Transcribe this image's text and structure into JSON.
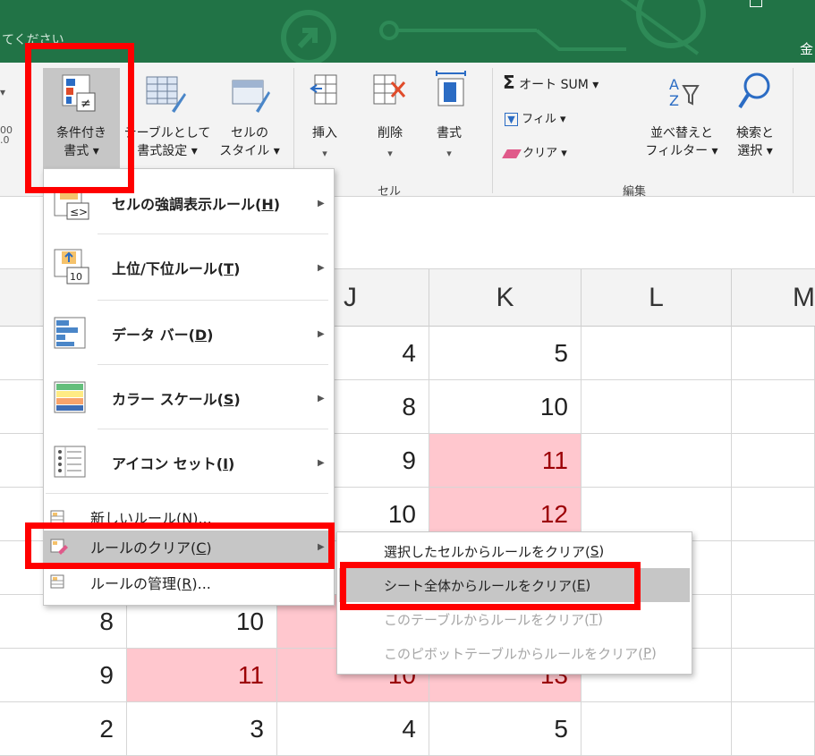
{
  "titlebar": {
    "left_text": "てください",
    "right_text": "金",
    "color": "#217346"
  },
  "ribbon": {
    "conditional_format": {
      "line1": "条件付き",
      "line2": "書式 ▾"
    },
    "format_as_table": {
      "line1": "テーブルとして",
      "line2": "書式設定 ▾"
    },
    "cell_styles": {
      "line1": "セルの",
      "line2": "スタイル ▾"
    },
    "insert": {
      "line1": "挿入",
      "line2": "▾"
    },
    "delete": {
      "line1": "削除",
      "line2": "▾"
    },
    "format": {
      "line1": "書式",
      "line2": "▾"
    },
    "autosum": "オート SUM  ▾",
    "fill": "フィル ▾",
    "clear": "クリア ▾",
    "sort_filter": {
      "line1": "並べ替えと",
      "line2": "フィルター ▾"
    },
    "find_select": {
      "line1": "検索と",
      "line2": "選択 ▾"
    },
    "group_cells": "セル",
    "group_edit": "編集",
    "left_partial": "00\n.0"
  },
  "grid": {
    "columns": [
      "J",
      "K",
      "L",
      "M"
    ],
    "rows": [
      {
        "cells": [
          "",
          "",
          "4",
          "5"
        ],
        "hl": [
          false,
          false,
          false,
          false
        ]
      },
      {
        "cells": [
          "",
          "",
          "8",
          "10"
        ],
        "hl": [
          false,
          false,
          false,
          false
        ]
      },
      {
        "cells": [
          "",
          "",
          "9",
          "11"
        ],
        "hl": [
          false,
          false,
          false,
          true
        ]
      },
      {
        "cells": [
          "",
          "",
          "10",
          "12"
        ],
        "hl": [
          false,
          false,
          false,
          true
        ]
      },
      {
        "cells": [
          "",
          "",
          "",
          ""
        ],
        "hl": [
          false,
          false,
          false,
          false
        ]
      },
      {
        "cells": [
          "8",
          "10",
          "",
          ""
        ],
        "hl": [
          false,
          false,
          true,
          true
        ]
      },
      {
        "cells": [
          "9",
          "11",
          "10",
          "13"
        ],
        "hl": [
          false,
          true,
          true,
          true
        ]
      },
      {
        "cells": [
          "2",
          "3",
          "4",
          "5"
        ],
        "hl": [
          false,
          false,
          false,
          false
        ]
      }
    ],
    "highlight_color": "#ffc7ce"
  },
  "menu": {
    "items": [
      {
        "label": "セルの強調表示ルール(",
        "key": "H",
        "suffix": ")"
      },
      {
        "label": "上位/下位ルール(",
        "key": "T",
        "suffix": ")"
      },
      {
        "label": "データ バー(",
        "key": "D",
        "suffix": ")"
      },
      {
        "label": "カラー スケール(",
        "key": "S",
        "suffix": ")"
      },
      {
        "label": "アイコン セット(",
        "key": "I",
        "suffix": ")"
      }
    ],
    "new_rule": "新しいルール(N)...",
    "clear_rules": {
      "label": "ルールのクリア(",
      "key": "C",
      "suffix": ")"
    },
    "manage_rules": {
      "label": "ルールの管理(",
      "key": "R",
      "suffix": ")..."
    }
  },
  "submenu": {
    "items": [
      {
        "label": "選択したセルからルールをクリア(",
        "key": "S",
        "suffix": ")",
        "enabled": true
      },
      {
        "label": "シート全体からルールをクリア(",
        "key": "E",
        "suffix": ")",
        "enabled": true
      },
      {
        "label": "このテーブルからルールをクリア(",
        "key": "T",
        "suffix": ")",
        "enabled": false
      },
      {
        "label": "このピボットテーブルからルールをクリア(",
        "key": "P",
        "suffix": ")",
        "enabled": false
      }
    ]
  },
  "icons": {
    "conditional_format": "conditional-format-icon",
    "format_table": "format-as-table-icon",
    "cell_styles": "cell-styles-icon",
    "insert": "insert-cells-icon",
    "delete": "delete-cells-icon",
    "format": "format-cells-icon",
    "autosum": "sigma-icon",
    "fill": "fill-down-icon",
    "clear": "eraser-icon",
    "sort": "sort-az-icon",
    "find": "magnifier-icon"
  }
}
